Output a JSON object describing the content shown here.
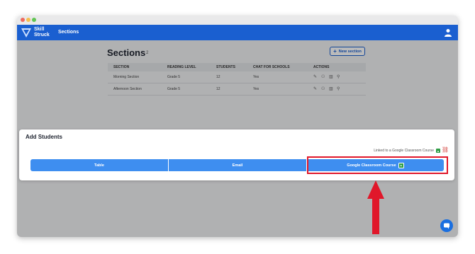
{
  "brand": {
    "line1": "Skill",
    "line2": "Struck"
  },
  "nav": {
    "sections": "Sections"
  },
  "page": {
    "title": "Sections",
    "count": "2",
    "new_button": "New section"
  },
  "table": {
    "headers": [
      "SECTION",
      "READING LEVEL",
      "STUDENTS",
      "CHAT FOR SCHOOLS",
      "ACTIONS"
    ],
    "rows": [
      [
        "Morning Section",
        "Grade 5",
        "12",
        "Yes"
      ],
      [
        "Afternoon Section",
        "Grade 5",
        "12",
        "Yes"
      ]
    ]
  },
  "modal": {
    "title": "Add Students",
    "gc_text": "Linked to a Google Classroom Course",
    "buttons": {
      "table": "Table",
      "email": "Email",
      "google": "Google Classroom Course"
    }
  },
  "colors": {
    "brand_blue": "#1a5fd0",
    "button_blue": "#3e8ef0",
    "highlight_red": "#e0172a",
    "google_green": "#2f9d45"
  },
  "icons": {
    "action_icons": [
      "pencil-icon",
      "users-icon",
      "trash-icon",
      "add-user-icon"
    ],
    "plus": "plus-icon",
    "chat": "chat-bubble-icon",
    "user": "user-icon"
  }
}
